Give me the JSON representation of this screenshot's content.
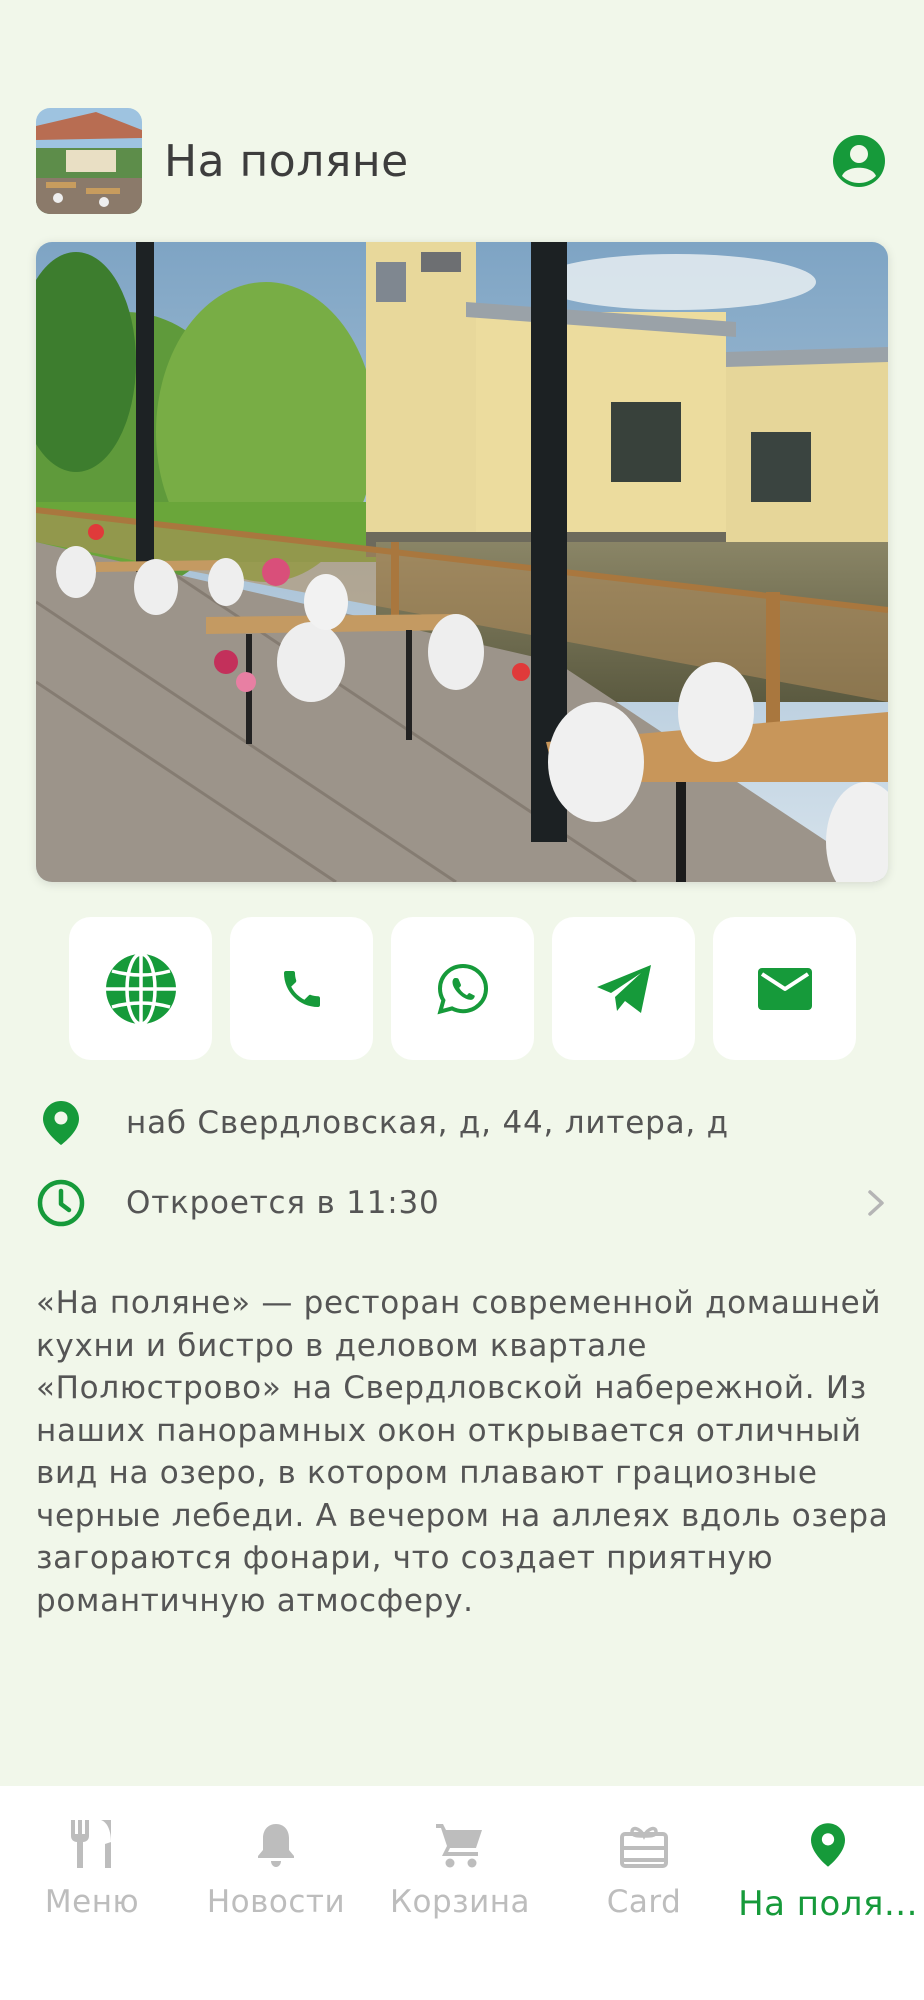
{
  "header": {
    "title": "На поляне"
  },
  "contact_buttons": [
    "website",
    "phone",
    "whatsapp",
    "telegram",
    "email"
  ],
  "address": "наб Свердловская, д, 44, литера, д",
  "hours": "Откроется в 11:30",
  "description": [
    "«На поляне» —  ресторан современной домашней",
    "кухни и бистро в деловом квартале",
    "«Полюстрово» на Свердловской набережной. Из",
    "наших панорамных окон открывается отличный",
    "вид на озеро, в котором плавают грациозные",
    "черные лебеди. А вечером на аллеях вдоль озера",
    "загораются фонари, что создает приятную",
    "романтичную атмосферу."
  ],
  "tabs": [
    {
      "label": "Меню",
      "icon": "fork-knife-icon"
    },
    {
      "label": "Новости",
      "icon": "bell-icon"
    },
    {
      "label": "Корзина",
      "icon": "cart-icon"
    },
    {
      "label": "Card",
      "icon": "gift-card-icon"
    },
    {
      "label": "На поля...",
      "icon": "location-pin-icon",
      "active": true
    }
  ],
  "colors": {
    "accent": "#169a3a",
    "background": "#f1f7ea",
    "inactive": "#bdbdbd"
  }
}
